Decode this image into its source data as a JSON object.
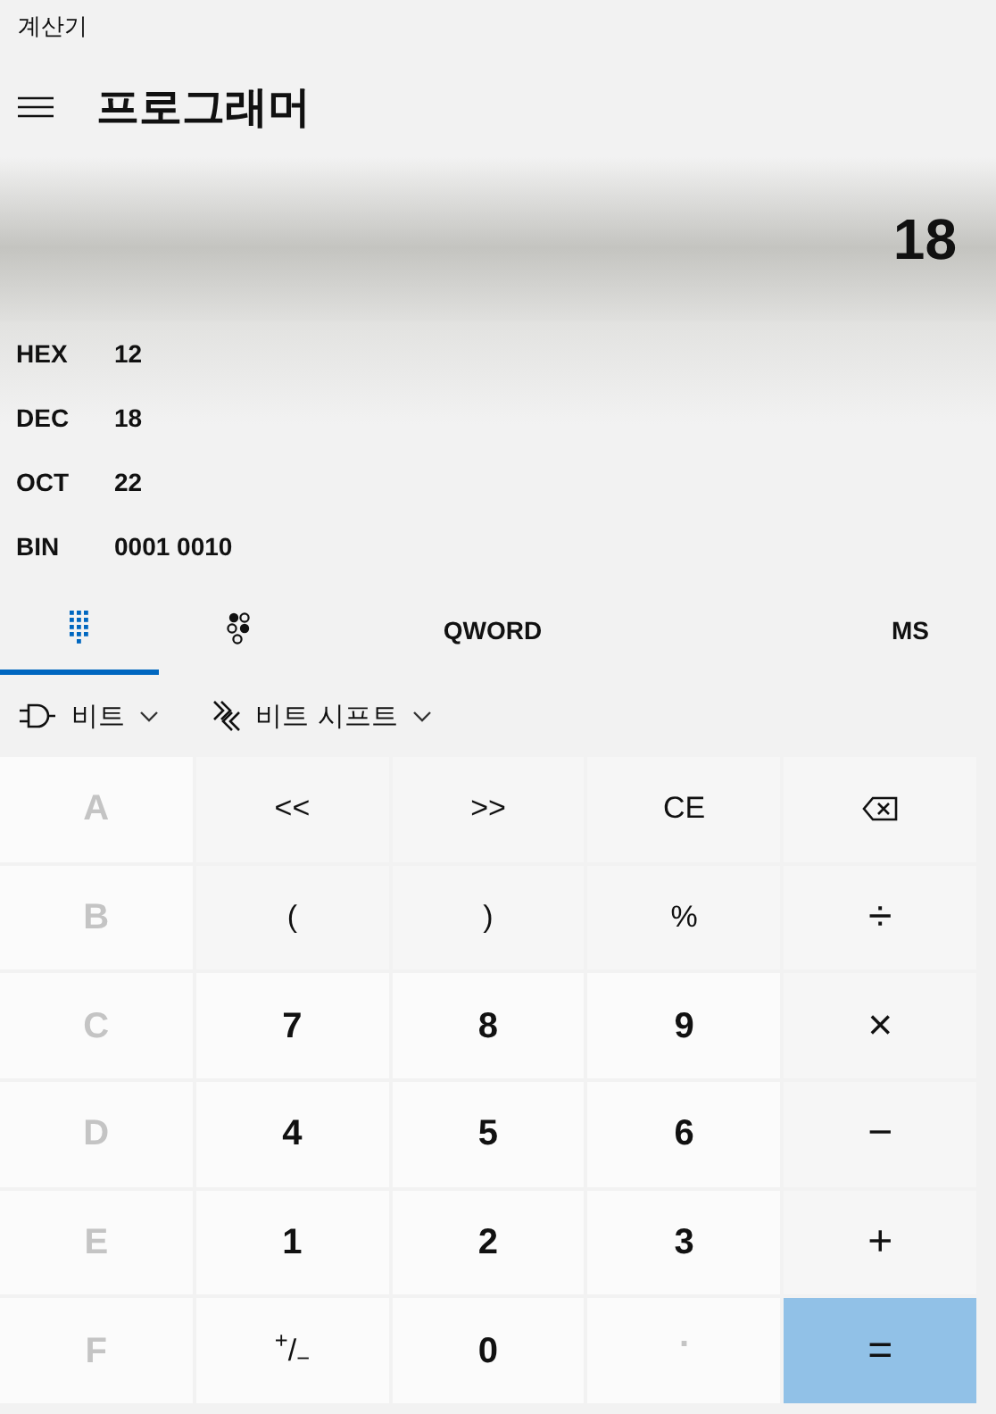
{
  "window": {
    "title": "계산기"
  },
  "header": {
    "title": "프로그래머"
  },
  "display": {
    "value": "18"
  },
  "radix": [
    {
      "name": "HEX",
      "value": "12",
      "selected": false
    },
    {
      "name": "DEC",
      "value": "18",
      "selected": false
    },
    {
      "name": "OCT",
      "value": "22",
      "selected": false
    },
    {
      "name": "BIN",
      "value": "0001 0010",
      "selected": false
    }
  ],
  "tabs": [
    {
      "kind": "keypad",
      "selected": true
    },
    {
      "kind": "bits",
      "selected": false
    }
  ],
  "word_size": "QWORD",
  "memory": "MS",
  "toolbar": [
    {
      "kind": "bitwise",
      "label": "비트"
    },
    {
      "kind": "shift",
      "label": "비트 시프트"
    }
  ],
  "keys": [
    {
      "label": "A",
      "kind": "digit",
      "disabled": true
    },
    {
      "label": "<<",
      "kind": "op",
      "disabled": false
    },
    {
      "label": ">>",
      "kind": "op",
      "disabled": false
    },
    {
      "label": "CE",
      "kind": "op",
      "disabled": false
    },
    {
      "kind": "backspace",
      "disabled": false
    },
    {
      "label": "B",
      "kind": "digit",
      "disabled": true
    },
    {
      "label": "(",
      "kind": "op",
      "disabled": false
    },
    {
      "label": ")",
      "kind": "op",
      "disabled": false
    },
    {
      "label": "%",
      "kind": "op",
      "disabled": false
    },
    {
      "label": "÷",
      "kind": "op",
      "disabled": false
    },
    {
      "label": "C",
      "kind": "digit",
      "disabled": true
    },
    {
      "label": "7",
      "kind": "digit",
      "disabled": false
    },
    {
      "label": "8",
      "kind": "digit",
      "disabled": false
    },
    {
      "label": "9",
      "kind": "digit",
      "disabled": false
    },
    {
      "label": "×",
      "kind": "op",
      "disabled": false
    },
    {
      "label": "D",
      "kind": "digit",
      "disabled": true
    },
    {
      "label": "4",
      "kind": "digit",
      "disabled": false
    },
    {
      "label": "5",
      "kind": "digit",
      "disabled": false
    },
    {
      "label": "6",
      "kind": "digit",
      "disabled": false
    },
    {
      "label": "−",
      "kind": "op",
      "disabled": false
    },
    {
      "label": "E",
      "kind": "digit",
      "disabled": true
    },
    {
      "label": "1",
      "kind": "digit",
      "disabled": false
    },
    {
      "label": "2",
      "kind": "digit",
      "disabled": false
    },
    {
      "label": "3",
      "kind": "digit",
      "disabled": false
    },
    {
      "label": "+",
      "kind": "op",
      "disabled": false
    },
    {
      "label": "F",
      "kind": "digit",
      "disabled": true
    },
    {
      "label": "$^{+}$/$_{−}$",
      "kind": "sign",
      "disabled": false
    },
    {
      "label": "0",
      "kind": "digit",
      "disabled": false
    },
    {
      "label": ".",
      "kind": "digit",
      "disabled": true
    },
    {
      "label": "=",
      "kind": "equals",
      "disabled": false
    }
  ]
}
